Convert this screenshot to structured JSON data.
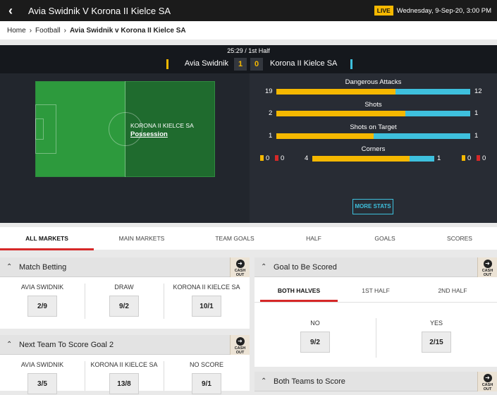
{
  "header": {
    "title": "Avia Swidnik V Korona II Kielce SA",
    "live_badge": "LIVE",
    "datetime": "Wednesday, 9-Sep-20, 3:00 PM"
  },
  "breadcrumb": {
    "home": "Home",
    "sport": "Football",
    "current": "Avia Swidnik v Korona II Kielce SA"
  },
  "match": {
    "clock": "25:29 / 1st Half",
    "home_team": "Avia Swidnik",
    "away_team": "Korona II Kielce SA",
    "home_score": "1",
    "away_score": "0",
    "possession_team": "KORONA II KIELCE SA",
    "possession_label": "Possession",
    "colors": {
      "home": "#f5b800",
      "away": "#3ec0dd"
    }
  },
  "stats": {
    "items": [
      {
        "title": "Dangerous Attacks",
        "home": "19",
        "away": "12",
        "home_value": 19,
        "away_value": 12
      },
      {
        "title": "Shots",
        "home": "2",
        "away": "1",
        "home_value": 2,
        "away_value": 1
      },
      {
        "title": "Shots on Target",
        "home": "1",
        "away": "1",
        "home_value": 1,
        "away_value": 1
      }
    ],
    "corners": {
      "title": "Corners",
      "home": "4",
      "away": "1",
      "home_value": 4,
      "away_value": 1,
      "home_yellow": "0",
      "home_red": "0",
      "away_yellow": "0",
      "away_red": "0"
    },
    "more_stats": "MORE STATS"
  },
  "tabs": {
    "all_markets": "ALL MARKETS",
    "main_markets": "MAIN MARKETS",
    "team_goals": "TEAM GOALS",
    "half": "HALF",
    "goals": "GOALS",
    "scores": "SCORES"
  },
  "cash_out": "CASH OUT",
  "match_betting": {
    "title": "Match Betting",
    "home_label": "AVIA SWIDNIK",
    "home_odds": "2/9",
    "draw_label": "DRAW",
    "draw_odds": "9/2",
    "away_label": "KORONA II KIELCE SA",
    "away_odds": "10/1"
  },
  "next_goal": {
    "title": "Next Team To Score Goal 2",
    "home_label": "AVIA SWIDNIK",
    "home_odds": "3/5",
    "away_label": "KORONA II KIELCE SA",
    "away_odds": "13/8",
    "none_label": "NO SCORE",
    "none_odds": "9/1"
  },
  "goal_scored": {
    "title": "Goal to Be Scored",
    "tab_both": "BOTH HALVES",
    "tab_first": "1ST HALF",
    "tab_second": "2ND HALF",
    "no_label": "NO",
    "no_odds": "9/2",
    "yes_label": "YES",
    "yes_odds": "2/15"
  },
  "btts": {
    "title": "Both Teams to Score"
  }
}
